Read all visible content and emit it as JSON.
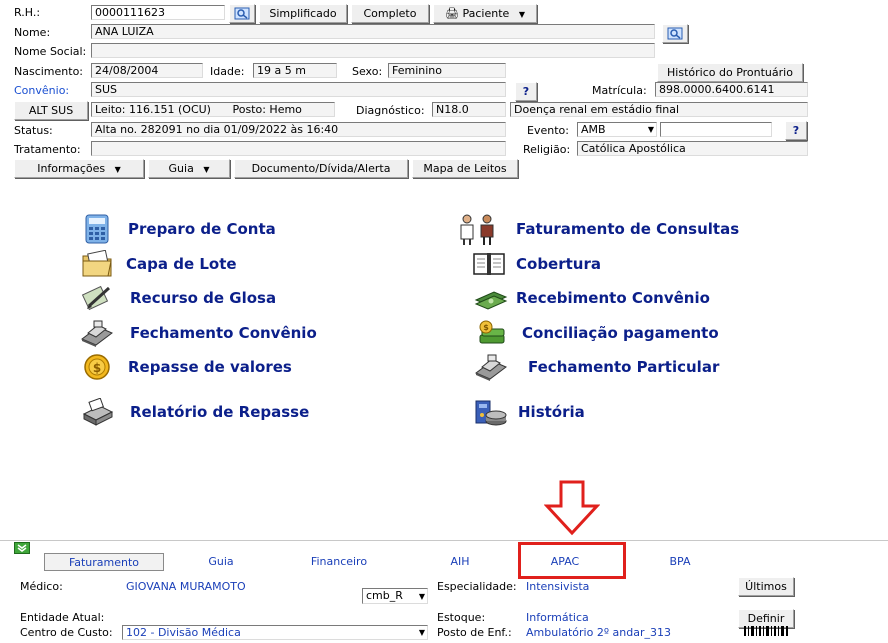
{
  "header": {
    "rh_label": "R.H.:",
    "rh_value": "0000111623",
    "simplificado_label": "Simplificado",
    "completo_label": "Completo",
    "paciente_label": "Paciente",
    "nome_label": "Nome:",
    "nome_value": "ANA LUIZA",
    "nome_social_label": "Nome Social:",
    "nome_social_value": "",
    "nascimento_label": "Nascimento:",
    "nascimento_value": "24/08/2004",
    "idade_label": "Idade:",
    "idade_value": "19 a 5 m",
    "sexo_label": "Sexo:",
    "sexo_value": "Feminino",
    "historico_label": "Histórico do Prontuário",
    "convenio_label": "Convênio:",
    "convenio_value": "SUS",
    "matricula_label": "Matrícula:",
    "matricula_value": "898.0000.6400.6141",
    "alt_sus_label": "ALT SUS",
    "leito_value": "Leito: 116.151 (OCU)",
    "posto_value": "Posto: Hemo",
    "diagnostico_label": "Diagnóstico:",
    "diagnostico_value": "N18.0",
    "diagnostico_desc": "Doença renal em estádio final",
    "status_label": "Status:",
    "status_value": "Alta no. 282091 no dia 01/09/2022 às  16:40",
    "evento_label": "Evento:",
    "evento_value": "AMB",
    "evento_extra": "",
    "tratamento_label": "Tratamento:",
    "tratamento_value": "",
    "religiao_label": "Religião:",
    "religiao_value": "Católica Apostólica",
    "question_mark": "?"
  },
  "toolbar": {
    "informacoes": "Informações",
    "guia": "Guia",
    "documento": "Documento/Dívida/Alerta",
    "mapa": "Mapa de Leitos"
  },
  "menu": {
    "left": [
      {
        "label": "Preparo de Conta",
        "icon": "calculator-icon"
      },
      {
        "label": "Capa de Lote",
        "icon": "folder-icon"
      },
      {
        "label": "Recurso de Glosa",
        "icon": "pen-document-icon"
      },
      {
        "label": "Fechamento Convênio",
        "icon": "cash-register-icon"
      },
      {
        "label": "Repasse de valores",
        "icon": "coin-icon"
      },
      {
        "label": "Relatório de Repasse",
        "icon": "printer-icon"
      }
    ],
    "right": [
      {
        "label": "Faturamento de Consultas",
        "icon": "doctor-patient-icon"
      },
      {
        "label": "Cobertura",
        "icon": "book-icon"
      },
      {
        "label": "Recebimento Convênio",
        "icon": "money-bills-icon"
      },
      {
        "label": "Conciliação pagamento",
        "icon": "money-stack-icon"
      },
      {
        "label": "Fechamento Particular",
        "icon": "cash-register-icon"
      },
      {
        "label": "História",
        "icon": "history-icon"
      }
    ]
  },
  "tabs": [
    {
      "label": "Faturamento"
    },
    {
      "label": "Guia"
    },
    {
      "label": "Financeiro"
    },
    {
      "label": "AIH"
    },
    {
      "label": "APAC"
    },
    {
      "label": "BPA"
    }
  ],
  "footer": {
    "medico_label": "Médico:",
    "medico_value": "GIOVANA MURAMOTO",
    "cmb_value": "cmb_R",
    "especialidade_label": "Especialidade:",
    "especialidade_value": "Intensivista",
    "ultimos_label": "Últimos",
    "entidade_label": "Entidade Atual:",
    "estoque_label": "Estoque:",
    "estoque_value": "Informática",
    "definir_label": "Definir",
    "centro_label": "Centro de Custo:",
    "centro_value": "102 - Divisão Médica",
    "posto_enf_label": "Posto de Enf.:",
    "posto_enf_value": "Ambulatório 2º andar_313"
  },
  "colors": {
    "menu_text": "#0b1f8a",
    "link_blue": "#1a4fd1",
    "highlight_red": "#e0201c"
  }
}
